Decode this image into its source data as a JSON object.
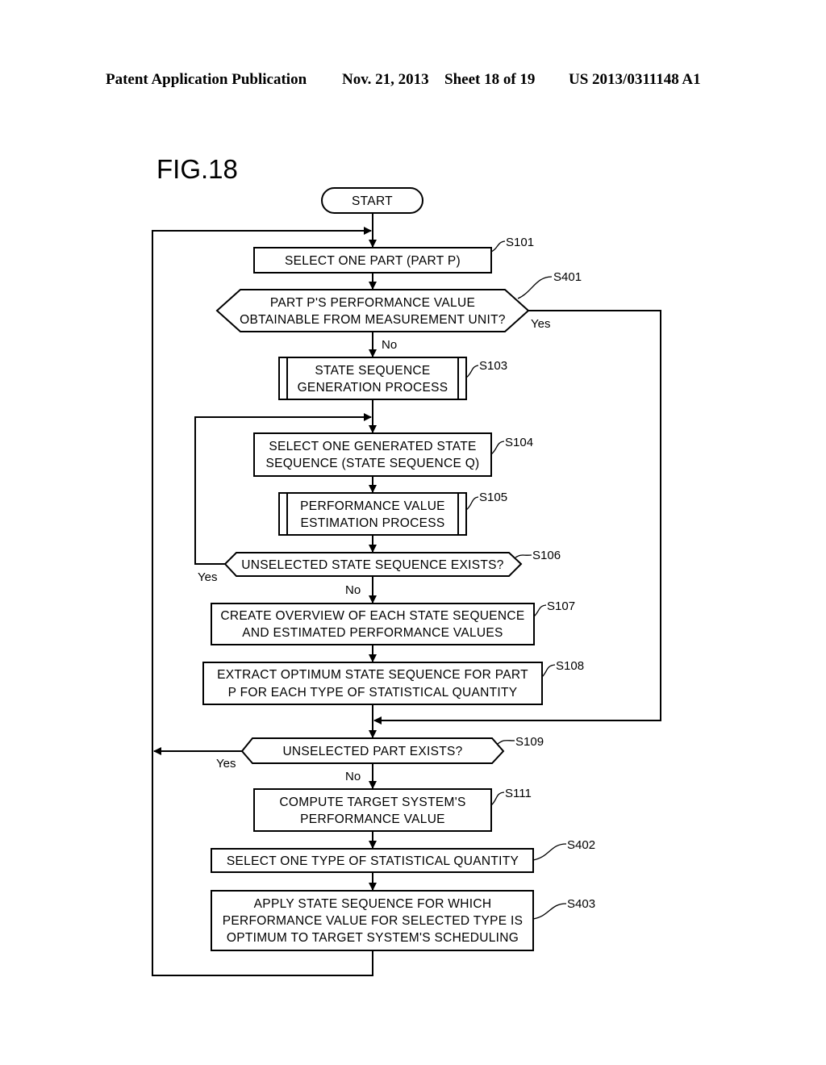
{
  "header": {
    "publication": "Patent Application Publication",
    "date": "Nov. 21, 2013",
    "sheet": "Sheet 18 of 19",
    "number": "US 2013/0311148 A1"
  },
  "figure": {
    "title": "FIG.18",
    "start": "START",
    "nodes": {
      "s101": {
        "step": "S101",
        "lines": [
          "SELECT ONE PART (PART P)"
        ]
      },
      "s401": {
        "step": "S401",
        "lines": [
          "PART P'S PERFORMANCE VALUE",
          "OBTAINABLE FROM MEASUREMENT UNIT?"
        ]
      },
      "s103": {
        "step": "S103",
        "lines": [
          "STATE SEQUENCE",
          "GENERATION PROCESS"
        ]
      },
      "s104": {
        "step": "S104",
        "lines": [
          "SELECT ONE GENERATED STATE",
          "SEQUENCE (STATE SEQUENCE Q)"
        ]
      },
      "s105": {
        "step": "S105",
        "lines": [
          "PERFORMANCE VALUE",
          "ESTIMATION PROCESS"
        ]
      },
      "s106": {
        "step": "S106",
        "lines": [
          "UNSELECTED STATE SEQUENCE EXISTS?"
        ]
      },
      "s107": {
        "step": "S107",
        "lines": [
          "CREATE OVERVIEW OF EACH STATE SEQUENCE",
          "AND ESTIMATED PERFORMANCE VALUES"
        ]
      },
      "s108": {
        "step": "S108",
        "lines": [
          "EXTRACT OPTIMUM STATE SEQUENCE FOR PART",
          "P FOR EACH TYPE OF STATISTICAL QUANTITY"
        ]
      },
      "s109": {
        "step": "S109",
        "lines": [
          "UNSELECTED PART EXISTS?"
        ]
      },
      "s111": {
        "step": "S111",
        "lines": [
          "COMPUTE TARGET SYSTEM'S",
          "PERFORMANCE VALUE"
        ]
      },
      "s402": {
        "step": "S402",
        "lines": [
          "SELECT ONE TYPE OF STATISTICAL QUANTITY"
        ]
      },
      "s403": {
        "step": "S403",
        "lines": [
          "APPLY STATE SEQUENCE FOR WHICH",
          "PERFORMANCE VALUE FOR SELECTED TYPE IS",
          "OPTIMUM TO TARGET SYSTEM'S SCHEDULING"
        ]
      }
    },
    "branch_labels": {
      "s401_yes": "Yes",
      "s401_no": "No",
      "s106_yes": "Yes",
      "s106_no": "No",
      "s109_yes": "Yes",
      "s109_no": "No"
    }
  }
}
